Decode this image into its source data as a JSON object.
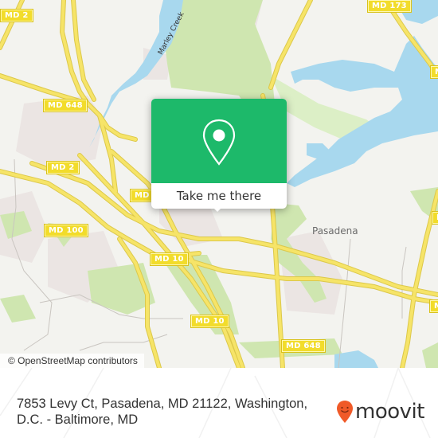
{
  "map": {
    "colors": {
      "land": "#f3f3ef",
      "water": "#a8d8ee",
      "park": "#cfe6b0",
      "residential": "#ebe5e3",
      "road": "#f6e468",
      "road_casing": "#dcc84a",
      "shield": "#f2dc2b"
    },
    "route_shields": [
      {
        "label": "MD 2"
      },
      {
        "label": "MD 648"
      },
      {
        "label": "MD 2"
      },
      {
        "label": "MD"
      },
      {
        "label": "MD 100"
      },
      {
        "label": "MD 10"
      },
      {
        "label": "MD 10"
      },
      {
        "label": "MD 648"
      },
      {
        "label": "MD 173"
      },
      {
        "label": "M"
      },
      {
        "label": "MD"
      },
      {
        "label": "M"
      }
    ],
    "place_labels": {
      "pasadena": "Pasadena",
      "creek": "Marley Creek"
    },
    "attribution": "© OpenStreetMap contributors"
  },
  "popup": {
    "icon": "location-pin-icon",
    "cta_label": "Take me there",
    "color": "#1db96a"
  },
  "footer": {
    "address": "7853 Levy Ct, Pasadena, MD 21122, Washington, D.C. - Baltimore, MD",
    "brand": "moovit",
    "brand_color": "#f05a28"
  }
}
